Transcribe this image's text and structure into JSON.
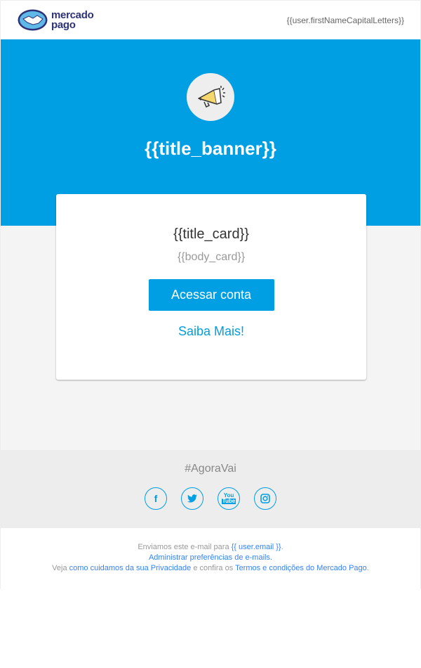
{
  "header": {
    "logo_text_1": "mercado",
    "logo_text_2": "pago",
    "user": "{{user.firstNameCapitalLetters}}"
  },
  "banner": {
    "title": "{{title_banner}}",
    "icon": "megaphone-icon"
  },
  "card": {
    "title": "{{title_card}}",
    "body": "{{body_card}}",
    "button": "Acessar conta",
    "link": "Saiba Mais!"
  },
  "social": {
    "hashtag": "#AgoraVai",
    "icons": [
      "facebook-icon",
      "twitter-icon",
      "youtube-icon",
      "instagram-icon"
    ]
  },
  "footer": {
    "line1_pre": "Enviamos este e-mail para ",
    "line1_link": "{{ user.email }}",
    "line1_post": ".",
    "line2_link": "Administrar preferências de e-mails.",
    "line3_pre": "Veja ",
    "line3_link1": "como cuidamos da sua Privacidade",
    "line3_mid": " e confira os ",
    "line3_link2": "Termos e condições do Mercado Pago",
    "line3_post": "."
  },
  "colors": {
    "brand": "#009ee3",
    "link": "#3483fa"
  }
}
